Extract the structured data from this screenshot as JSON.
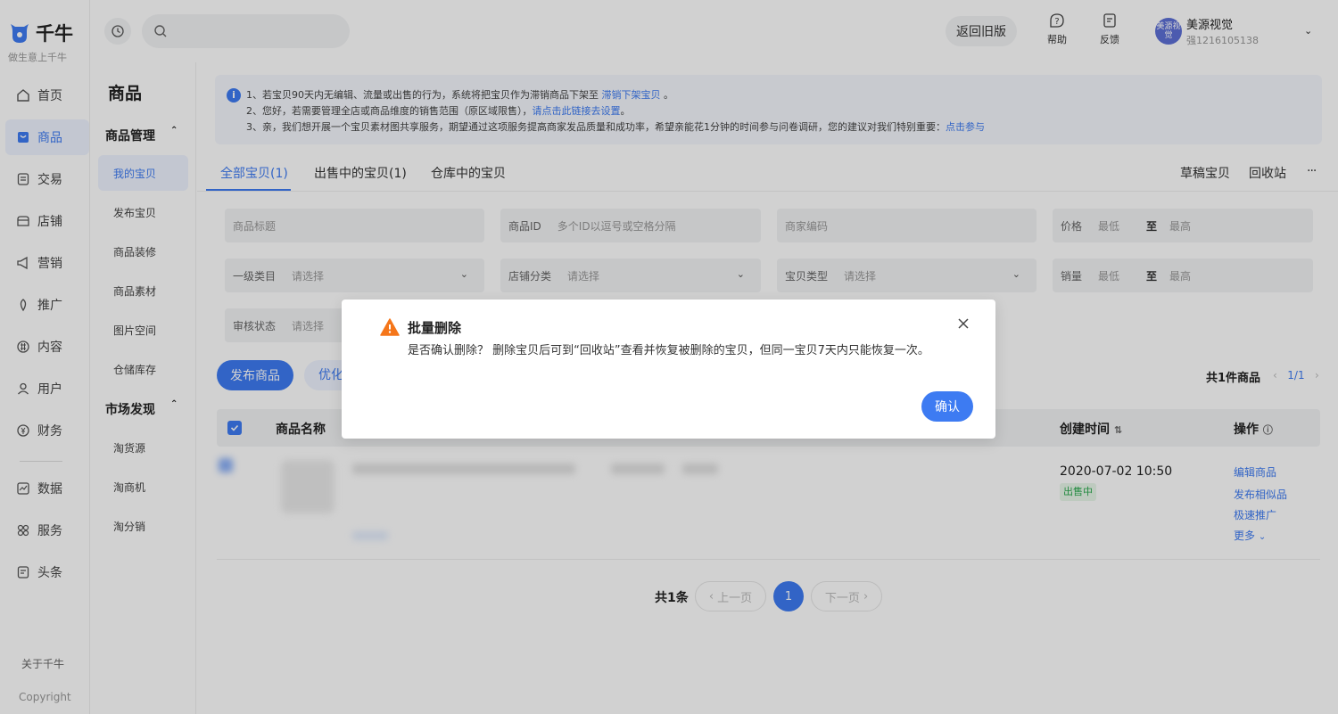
{
  "brand": {
    "name": "千牛",
    "slogan": "做生意上千牛"
  },
  "nav": {
    "items": [
      {
        "label": "首页",
        "icon": "home-icon"
      },
      {
        "label": "商品",
        "icon": "goods-icon"
      },
      {
        "label": "交易",
        "icon": "trade-icon"
      },
      {
        "label": "店铺",
        "icon": "shop-icon"
      },
      {
        "label": "营销",
        "icon": "marketing-icon"
      },
      {
        "label": "推广",
        "icon": "promote-icon"
      },
      {
        "label": "内容",
        "icon": "content-icon"
      },
      {
        "label": "用户",
        "icon": "user-icon"
      },
      {
        "label": "财务",
        "icon": "finance-icon"
      },
      {
        "label": "数据",
        "icon": "data-icon"
      },
      {
        "label": "服务",
        "icon": "service-icon"
      },
      {
        "label": "头条",
        "icon": "news-icon"
      }
    ],
    "about": "关于千牛",
    "copyright": "Copyright"
  },
  "subnav": {
    "title": "商品",
    "group1": "商品管理",
    "group1_items": [
      "我的宝贝",
      "发布宝贝",
      "商品装修",
      "商品素材",
      "图片空间",
      "仓储库存"
    ],
    "group2": "市场发现",
    "group2_items": [
      "淘货源",
      "淘商机",
      "淘分销"
    ]
  },
  "topbar": {
    "old_version": "返回旧版",
    "help": "帮助",
    "feedback": "反馈",
    "avatar_text": "美源视觉",
    "user_name": "美源视觉",
    "user_id": "强1216105138"
  },
  "notice": {
    "line1": "1、若宝贝90天内无编辑、流量或出售的行为，系统将把宝贝作为滞销商品下架至",
    "line1_link": "滞销下架宝贝",
    "line1_end": "。",
    "line2": "2、您好，若需要管理全店或商品维度的销售范围（原区域限售），",
    "line2_link": "请点击此链接去设置",
    "line2_end": "。",
    "line3": "3、亲，我们想开展一个宝贝素材图共享服务，期望通过这项服务提高商家发品质量和成功率，希望亲能花1分钟的时间参与问卷调研，您的建议对我们特别重要：",
    "line3_link": "点击参与"
  },
  "tabs": [
    "全部宝贝(1)",
    "出售中的宝贝(1)",
    "仓库中的宝贝"
  ],
  "tab_links": {
    "draft": "草稿宝贝",
    "recycle": "回收站",
    "more": "···"
  },
  "filters": {
    "title": "商品标题",
    "id": "商品ID",
    "id_ph": "多个ID以逗号或空格分隔",
    "code": "商家编码",
    "price": "价格",
    "min": "最低",
    "to": "至",
    "max": "最高",
    "cat": "一级类目",
    "select": "请选择",
    "shopcat": "店铺分类",
    "type": "宝贝类型",
    "sales": "销量",
    "audit": "审核状态"
  },
  "actions": {
    "publish": "发布商品",
    "optimize": "优化"
  },
  "summary": {
    "total": "共1件商品",
    "page": "1/1"
  },
  "table": {
    "headers": {
      "name": "商品名称",
      "created": "创建时间",
      "ops": "操作"
    },
    "row": {
      "date": "2020-07-02 10:50",
      "status": "出售中",
      "ops": [
        "编辑商品",
        "发布相似品",
        "极速推广",
        "更多"
      ]
    }
  },
  "pagination": {
    "total": "共1条",
    "prev": "上一页",
    "current": "1",
    "next": "下一页"
  },
  "modal": {
    "title": "批量删除",
    "body": "是否确认删除？ 删除宝贝后可到“回收站”查看并恢复被删除的宝贝，但同一宝贝7天内只能恢复一次。",
    "confirm": "确认"
  },
  "colors": {
    "accent": "#3d7bf2",
    "warning": "#f5761a",
    "success": "#2aa94d"
  }
}
